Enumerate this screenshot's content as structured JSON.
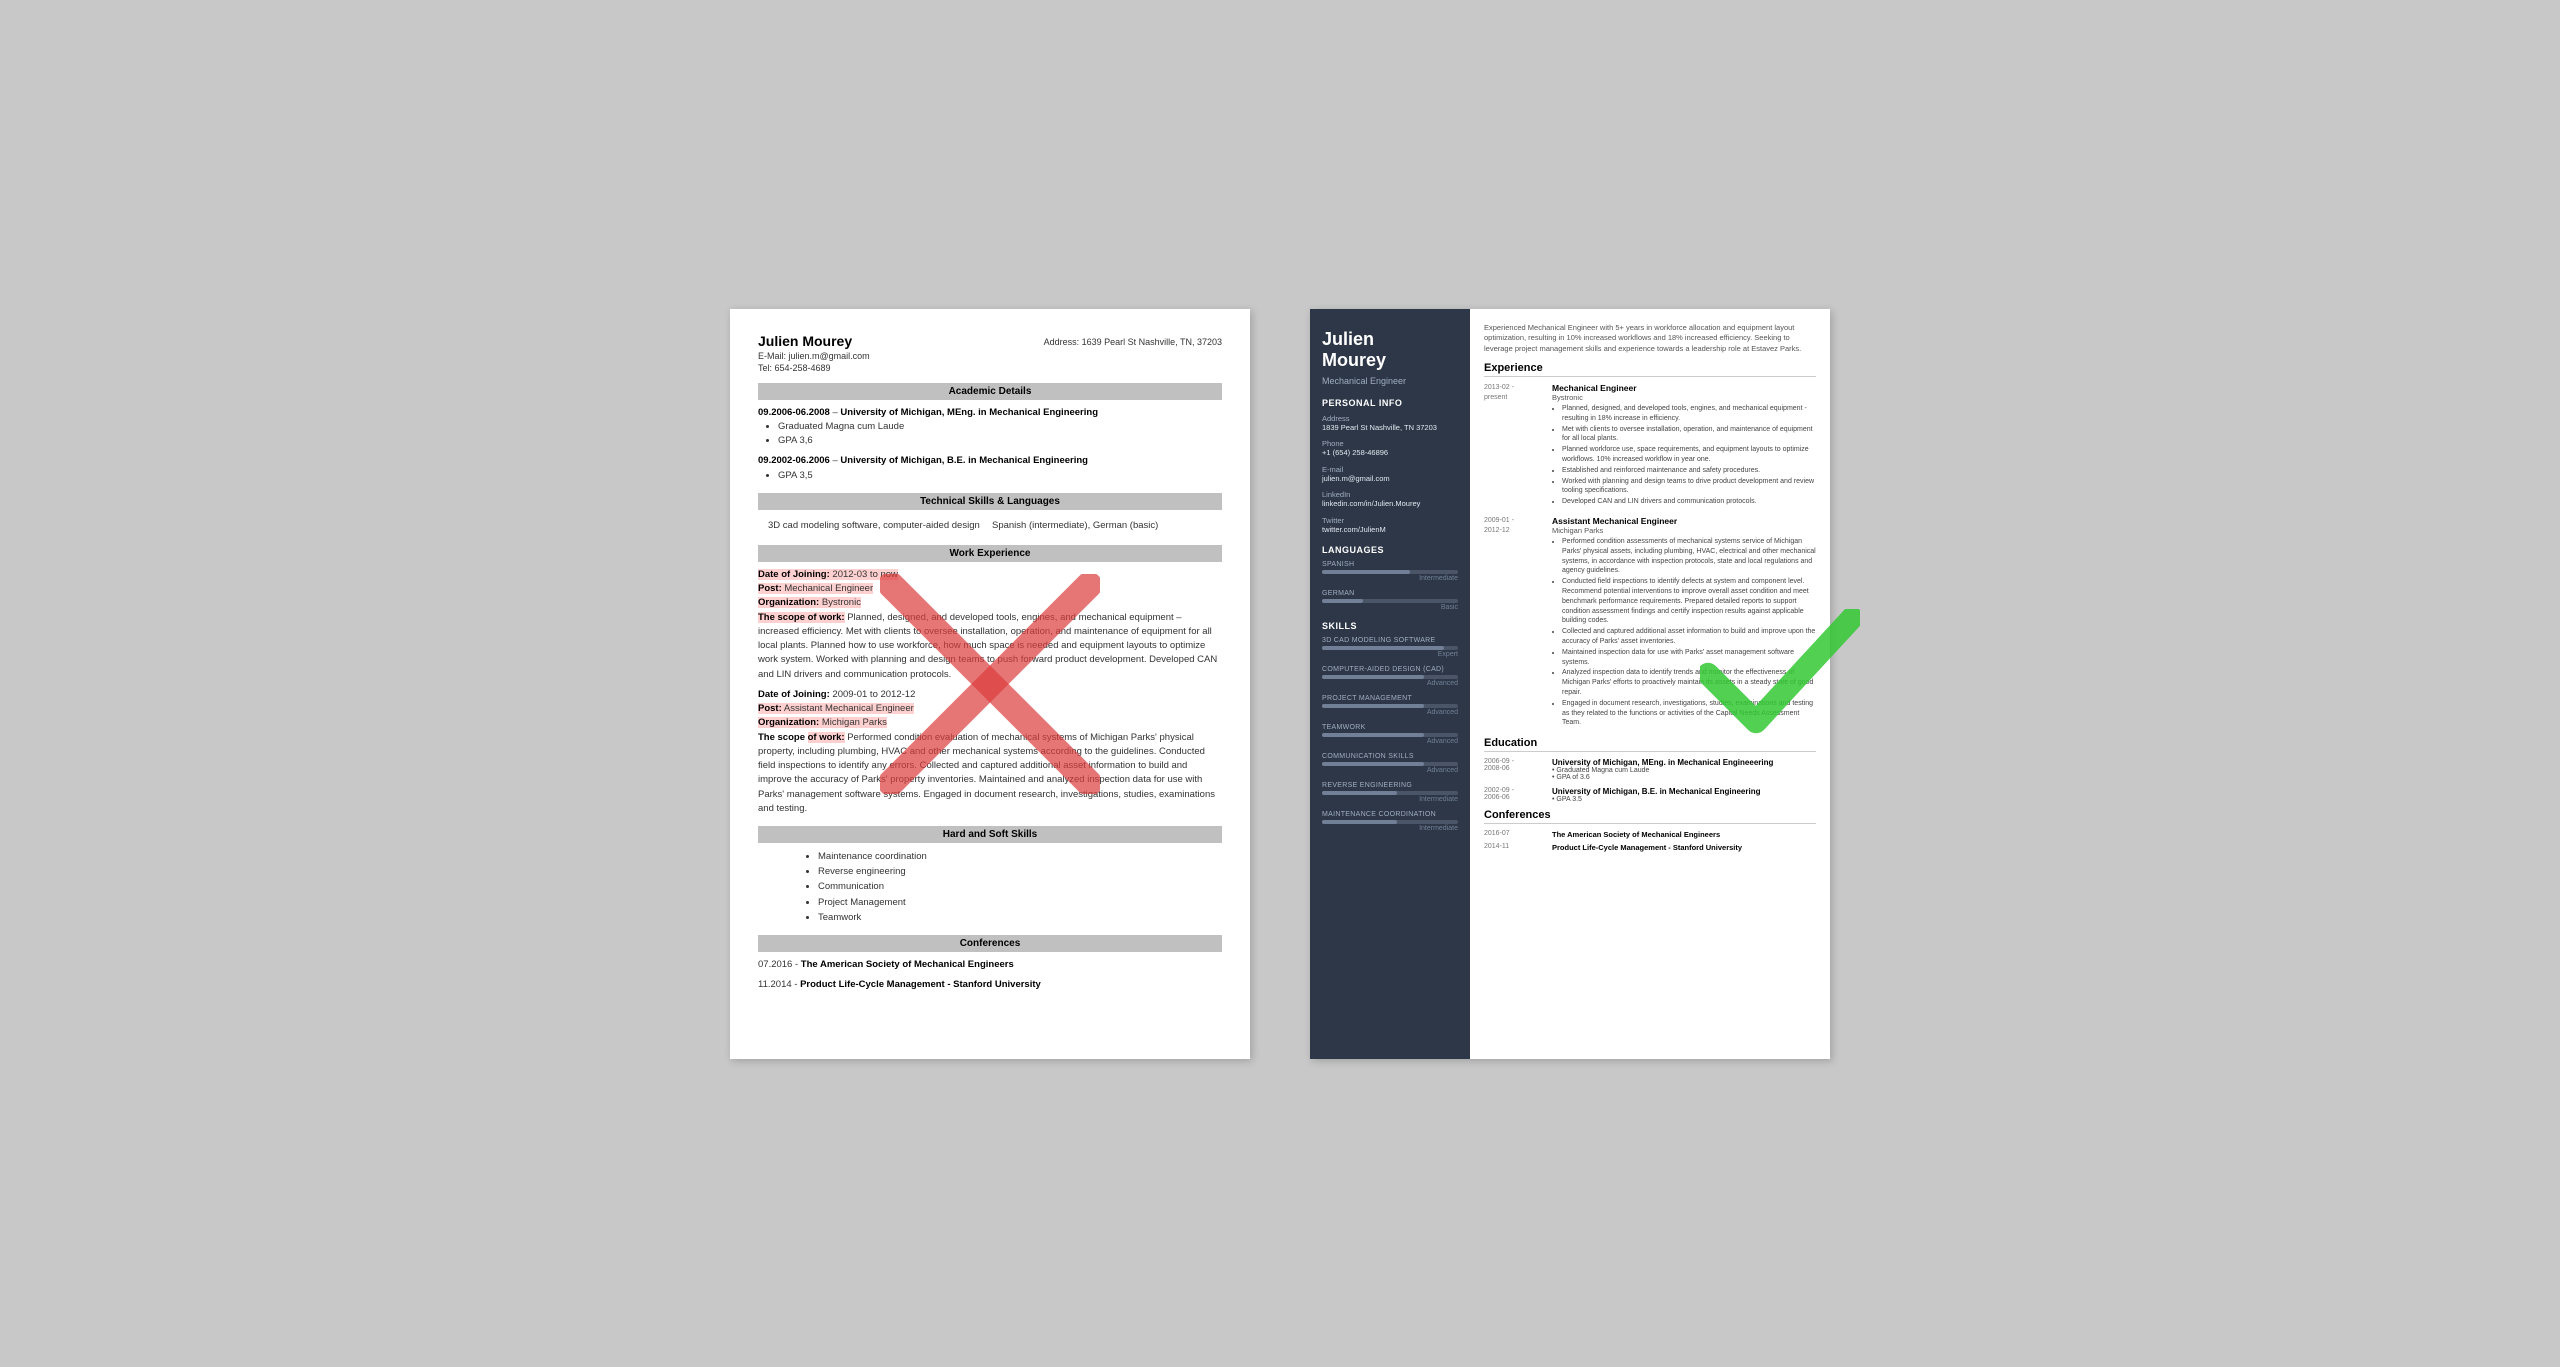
{
  "left_resume": {
    "name": "Julien Mourey",
    "email": "E-Mail: julien.m@gmail.com",
    "phone": "Tel: 654-258-4689",
    "address": "Address: 1639 Pearl St Nashville, TN, 37203",
    "sections": {
      "academic": {
        "title": "Academic Details",
        "entries": [
          {
            "date": "09.2006-06.2008",
            "degree": "University of Michigan, MEng. in Mechanical Engineering",
            "bullets": [
              "Graduated Magna cum Laude",
              "GPA 3,6"
            ]
          },
          {
            "date": "09.2002-06.2006",
            "degree": "University of Michigan, B.E. in Mechanical Engineering",
            "bullets": [
              "GPA 3,5"
            ]
          }
        ]
      },
      "technical": {
        "title": "Technical Skills & Languages",
        "col1": "3D cad modeling software, computer-aided design",
        "col2": "Spanish (intermediate), German (basic)"
      },
      "work": {
        "title": "Work Experience",
        "entries": [
          {
            "date_label": "Date of Joining:",
            "date": "2012-03 to now",
            "post_label": "Post:",
            "post": "Mechanical Engineer",
            "org_label": "Organization:",
            "org": "Bystronic",
            "scope_label": "The scope of work:",
            "scope": "Planned, designed, and developed tools, engines, and mechanical equipment – increased efficiency. Met with clients to oversee installation, operation, and maintenance of equipment for all local plants. Planned how to use workforce, how much space is needed and equipment layouts to optimize work system. Worked with planning and design teams to push forward product development. Developed CAN and LIN drivers and communication protocols."
          },
          {
            "date_label": "Date of Joining:",
            "date": "2009-01 to 2012-12",
            "post_label": "Post:",
            "post": "Assistant Mechanical Engineer",
            "org_label": "Organization:",
            "org": "Michigan Parks",
            "scope_label": "The scope of work:",
            "scope": "Performed condition evaluation of mechanical systems of Michigan Parks' physical property, including plumbing, HVAC and other mechanical systems according to the guidelines. Conducted field inspections to identify any errors. Collected and captured additional asset information to build and improve the accuracy of Parks' property inventories. Maintained and analyzed inspection data for use with Parks' management software systems. Engaged in document research, investigations, studies, examinations and testing."
          }
        ]
      },
      "hard_soft": {
        "title": "Hard and Soft Skills",
        "items": [
          "Maintenance coordination",
          "Reverse engineering",
          "Communication",
          "Project Management",
          "Teamwork"
        ]
      },
      "conferences": {
        "title": "Conferences",
        "entries": [
          {
            "date": "07.2016",
            "title": "The American Society of Mechanical Engineers"
          },
          {
            "date": "11.2014",
            "title": "Product Life-Cycle Management - Stanford University"
          }
        ]
      }
    }
  },
  "right_resume": {
    "name": "Julien\nMourey",
    "title": "Mechanical Engineer",
    "personal_info": {
      "section_title": "Personal Info",
      "address_label": "Address",
      "address": "1839 Pearl St Nashville, TN 37203",
      "phone_label": "Phone",
      "phone": "+1 (654) 258-46896",
      "email_label": "E-mail",
      "email": "julien.m@gmail.com",
      "linkedin_label": "LinkedIn",
      "linkedin": "linkedin.com/in/Julien.Mourey",
      "twitter_label": "Twitter",
      "twitter": "twitter.com/JulienM"
    },
    "languages": {
      "section_title": "Languages",
      "items": [
        {
          "name": "SPANISH",
          "level": "Intermediate",
          "pct": 65
        },
        {
          "name": "GERMAN",
          "level": "Basic",
          "pct": 30
        }
      ]
    },
    "skills": {
      "section_title": "Skills",
      "items": [
        {
          "name": "3D CAD MODELING SOFTWARE",
          "level": "Expert",
          "pct": 90
        },
        {
          "name": "COMPUTER-AIDED DESIGN (CAD)",
          "level": "Advanced",
          "pct": 75
        },
        {
          "name": "PROJECT MANAGEMENT",
          "level": "Advanced",
          "pct": 75
        },
        {
          "name": "TEAMWORK",
          "level": "Advanced",
          "pct": 75
        },
        {
          "name": "COMMUNICATION SKILLS",
          "level": "Advanced",
          "pct": 75
        },
        {
          "name": "REVERSE ENGINEERING",
          "level": "Intermediate",
          "pct": 55
        },
        {
          "name": "MAINTENANCE COORDINATION",
          "level": "Intermediate",
          "pct": 55
        }
      ]
    },
    "summary": "Experienced Mechanical Engineer with 5+ years in workforce allocation and equipment layout optimization, resulting in 10% increased workflows and 18% increased efficiency. Seeking to leverage project management skills and experience towards a leadership role at Estavez Parks.",
    "experience": {
      "section_title": "Experience",
      "entries": [
        {
          "date_start": "2013-02 -",
          "date_end": "present",
          "title": "Mechanical Engineer",
          "company": "Bystronic",
          "bullets": [
            "Planned, designed, and developed tools, engines, and mechanical equipment - resulting in 18% increase in efficiency.",
            "Met with clients to oversee installation, operation, and maintenance of equipment for all local plants.",
            "Planned workforce use, space requirements, and equipment layouts to optimize workflows. 10% increased workflow in year one.",
            "Established and reinforced maintenance and safety procedures.",
            "Worked with planning and design teams to drive product development and review tooling specifications.",
            "Developed CAN and LIN drivers and communication protocols."
          ]
        },
        {
          "date_start": "2009-01 -",
          "date_end": "2012-12",
          "title": "Assistant Mechanical Engineer",
          "company": "Michigan Parks",
          "bullets": [
            "Performed condition assessments of mechanical systems service of Michigan Parks' physical assets, including plumbing, HVAC, electrical and other mechanical systems, in accordance with inspection protocols, state and local regulations and agency guidelines.",
            "Conducted field inspections to identify defects at system and component level. Recommend potential interventions to improve overall asset condition and meet benchmark performance requirements. Prepared detailed reports to support condition assessment findings and certify inspection results against applicable building codes.",
            "Collected and captured additional asset information to build and improve upon the accuracy of Parks' asset inventories.",
            "Maintained inspection data for use with Parks' asset management software systems.",
            "Analyzed inspection data to identify trends and monitor the effectiveness of Michigan Parks' efforts to proactively maintain its assets in a steady state of good repair.",
            "Engaged in document research, investigations, studies, examinations and testing as they related to the functions or activities of the Capital Needs Assessment Team."
          ]
        }
      ]
    },
    "education": {
      "section_title": "Education",
      "entries": [
        {
          "date": "2006-09 - 2008-06",
          "title": "University of Michigan, MEng. in Mechanical Engineeering",
          "bullets": [
            "Graduated Magna cum Laude",
            "GPA of 3.6"
          ]
        },
        {
          "date": "2002-09 - 2006-06",
          "title": "University of Michigan, B.E. in Mechanical Engineering",
          "bullets": [
            "GPA 3.5"
          ]
        }
      ]
    },
    "conferences": {
      "section_title": "Conferences",
      "entries": [
        {
          "date": "2016-07",
          "title": "The American Society of Mechanical Engineers"
        },
        {
          "date": "2014-11",
          "title": "Product Life-Cycle Management - Stanford University"
        }
      ]
    }
  }
}
